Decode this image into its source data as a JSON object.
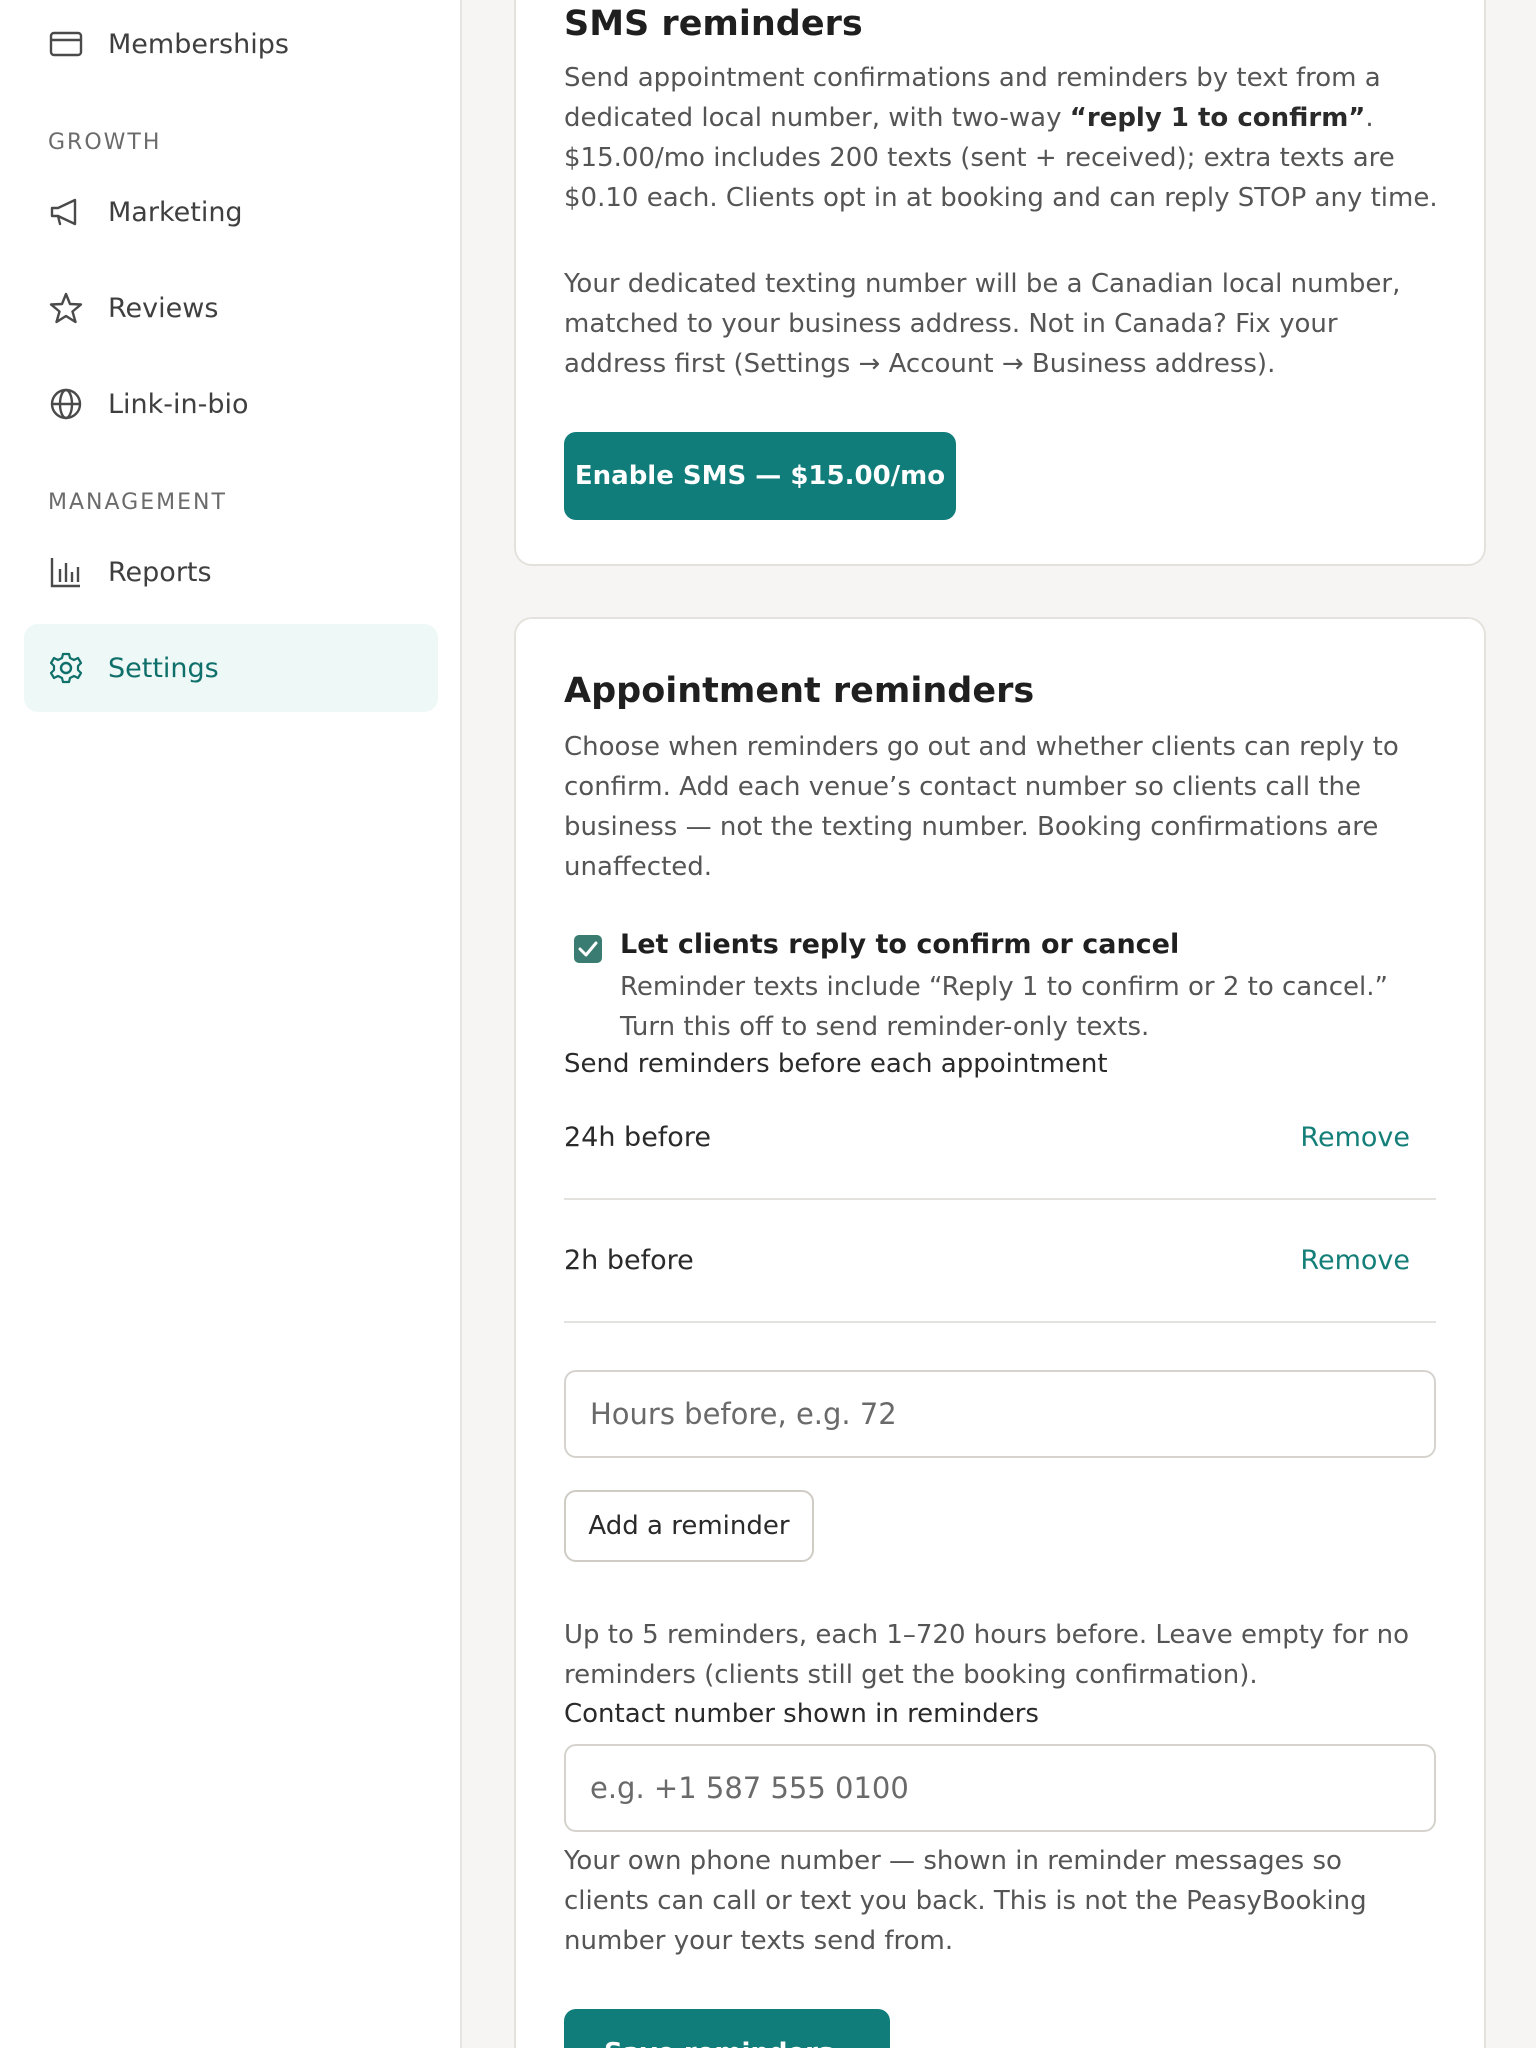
{
  "sidebar": {
    "items": [
      {
        "label": "Memberships",
        "icon": "card-icon"
      },
      {
        "label": "Marketing",
        "icon": "megaphone-icon"
      },
      {
        "label": "Reviews",
        "icon": "star-icon"
      },
      {
        "label": "Link-in-bio",
        "icon": "globe-icon"
      },
      {
        "label": "Reports",
        "icon": "bar-chart-icon"
      },
      {
        "label": "Settings",
        "icon": "gear-icon",
        "active": true
      }
    ],
    "sections": {
      "growth": "GROWTH",
      "management": "MANAGEMENT"
    }
  },
  "sms": {
    "title": "SMS reminders",
    "desc_part1": "Send appointment confirmations and reminders by text from a dedicated local number, with two-way ",
    "desc_bold": "“reply 1 to confirm”",
    "desc_part2": ". $15.00/mo includes 200 texts (sent + received); extra texts are $0.10 each. Clients opt in at booking and can reply STOP any time.",
    "note": "Your dedicated texting number will be a Canadian local number, matched to your business address. Not in Canada? Fix your address first (Settings → Account → Business address).",
    "enable_label": "Enable SMS — $15.00/mo"
  },
  "reminders": {
    "title": "Appointment reminders",
    "desc": "Choose when reminders go out and whether clients can reply to confirm. Add each venue’s contact number so clients call the business — not the texting number. Booking confirmations are unaffected.",
    "reply_label": "Let clients reply to confirm or cancel",
    "reply_help": "Reminder texts include “Reply 1 to confirm or 2 to cancel.” Turn this off to send reminder-only texts.",
    "reply_checked": true,
    "send_label": "Send reminders before each appointment",
    "items": [
      {
        "label": "24h before",
        "action": "Remove"
      },
      {
        "label": "2h before",
        "action": "Remove"
      }
    ],
    "hours_placeholder": "Hours before, e.g. 72",
    "add_label": "Add a reminder",
    "limits_help": "Up to 5 reminders, each 1–720 hours before. Leave empty for no reminders (clients still get the booking confirmation).",
    "contact_label": "Contact number shown in reminders",
    "contact_placeholder": "e.g. +1 587 555 0100",
    "contact_help": "Your own phone number — shown in reminder messages so clients can call or text you back. This is not the PeasyBooking number your texts send from.",
    "save_label": "Save reminders"
  },
  "colors": {
    "accent": "#117d7a",
    "active_bg": "#eef8f6",
    "link": "#147f78"
  }
}
